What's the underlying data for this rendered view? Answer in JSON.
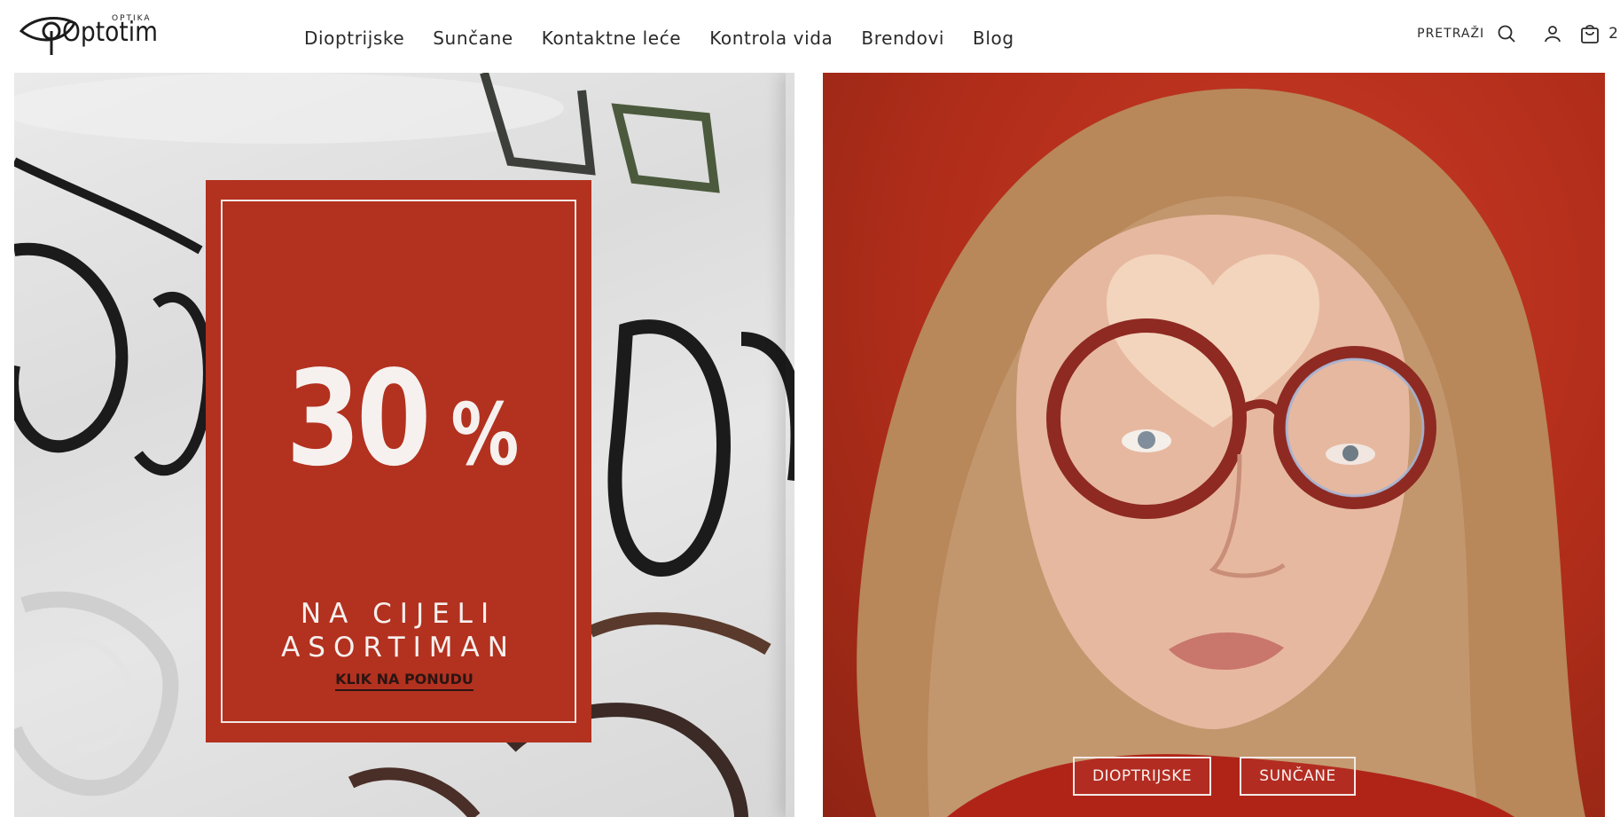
{
  "header": {
    "logo": {
      "small_text": "OPTIKA",
      "brand": "Optotim"
    },
    "nav": [
      {
        "label": "Dioptrijske"
      },
      {
        "label": "Sunčane"
      },
      {
        "label": "Kontaktne leće"
      },
      {
        "label": "Kontrola vida"
      },
      {
        "label": "Brendovi"
      },
      {
        "label": "Blog"
      }
    ],
    "search_label": "PRETRAŽI",
    "cart_count": "2",
    "icons": {
      "search": "search-icon",
      "account": "user-icon",
      "cart": "cart-icon"
    }
  },
  "promo": {
    "percent_number": "30",
    "percent_sign": "%",
    "line1": "NA CIJELI",
    "line2": "ASORTIMAN",
    "link_label": "KLIK NA PONUDU"
  },
  "hero": {
    "buttons": [
      {
        "label": "DIOPTRIJSKE"
      },
      {
        "label": "SUNČANE"
      }
    ]
  },
  "colors": {
    "promo_card": "#b3311f",
    "hero_background": "#b02d1a",
    "text_dark": "#2a2a2a"
  }
}
